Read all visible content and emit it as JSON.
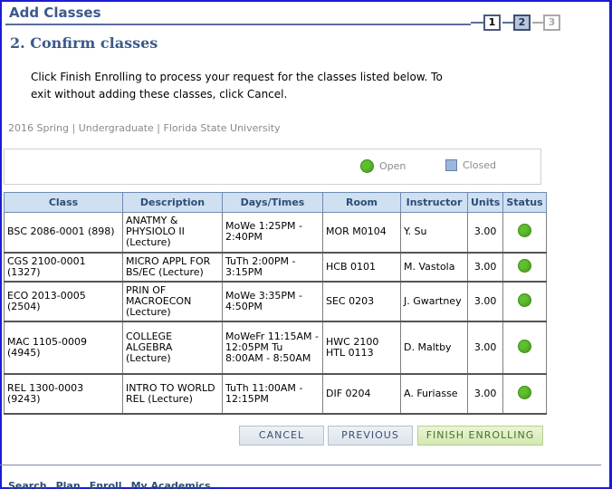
{
  "header": {
    "page_title": "Add Classes",
    "steps": [
      "1",
      "2",
      "3"
    ],
    "current_step": 2
  },
  "section_title": "2.  Confirm classes",
  "instructions": "Click Finish Enrolling to process your request for the classes listed below. To exit without adding these classes, click Cancel.",
  "term_info": "2016 Spring | Undergraduate | Florida State University",
  "legend": {
    "open_label": "Open",
    "closed_label": "Closed",
    "open_color": "#5ec02e",
    "closed_color": "#9ab6dc"
  },
  "table": {
    "columns": [
      "Class",
      "Description",
      "Days/Times",
      "Room",
      "Instructor",
      "Units",
      "Status"
    ],
    "rows": [
      {
        "class": "BSC 2086-0001 (898)",
        "description": "ANATMY & PHYSIOLO II (Lecture)",
        "days_times": "MoWe 1:25PM - 2:40PM",
        "room": "MOR M0104",
        "instructor": "Y. Su",
        "units": "3.00",
        "status": "Open"
      },
      {
        "class": "CGS 2100-0001 (1327)",
        "description": "MICRO APPL FOR BS/EC (Lecture)",
        "days_times": "TuTh 2:00PM - 3:15PM",
        "room": "HCB 0101",
        "instructor": "M. Vastola",
        "units": "3.00",
        "status": "Open"
      },
      {
        "class": "ECO 2013-0005 (2504)",
        "description": "PRIN OF MACROECON (Lecture)",
        "days_times": "MoWe 3:35PM - 4:50PM",
        "room": "SEC 0203",
        "instructor": "J. Gwartney",
        "units": "3.00",
        "status": "Open"
      },
      {
        "class": "MAC 1105-0009 (4945)",
        "description": "COLLEGE ALGEBRA (Lecture)",
        "days_times": "MoWeFr 11:15AM - 12:05PM Tu 8:00AM - 8:50AM",
        "room": "HWC 2100 HTL 0113",
        "instructor": "D. Maltby",
        "units": "3.00",
        "status": "Open"
      },
      {
        "class": "REL 1300-0003 (9243)",
        "description": "INTRO TO WORLD REL (Lecture)",
        "days_times": "TuTh 11:00AM - 12:15PM",
        "room": "DIF 0204",
        "instructor": "A. Furiasse",
        "units": "3.00",
        "status": "Open"
      }
    ]
  },
  "buttons": {
    "cancel": "CANCEL",
    "previous": "PREVIOUS",
    "finish": "FINISH ENROLLING"
  },
  "bottom_nav": [
    "Search",
    "Plan",
    "Enroll",
    "My Academics"
  ]
}
